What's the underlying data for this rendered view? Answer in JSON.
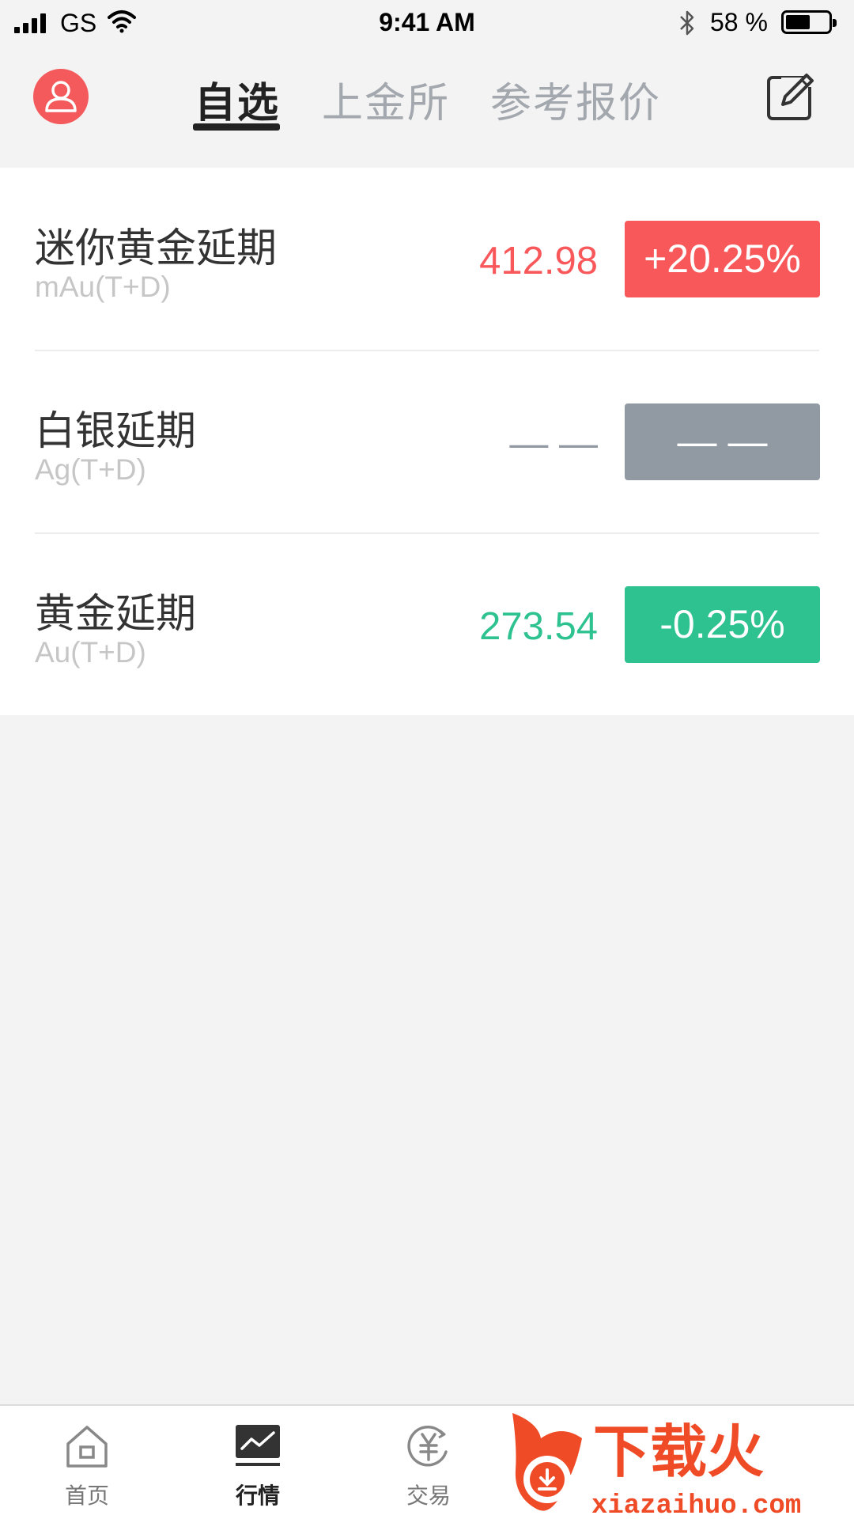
{
  "status_bar": {
    "carrier": "GS",
    "time": "9:41 AM",
    "battery_percent": "58 %",
    "battery_level": 0.58
  },
  "top_nav": {
    "tabs": [
      {
        "label": "自选",
        "active": true
      },
      {
        "label": "上金所",
        "active": false
      },
      {
        "label": "参考报价",
        "active": false
      }
    ],
    "avatar_icon": "user-icon",
    "edit_icon": "edit-icon"
  },
  "quotes": [
    {
      "name": "迷你黄金延期",
      "code": "mAu(T+D)",
      "price": "412.98",
      "change": "+20.25%",
      "trend": "up"
    },
    {
      "name": "白银延期",
      "code": "Ag(T+D)",
      "price": "— —",
      "change": "— —",
      "trend": "none"
    },
    {
      "name": "黄金延期",
      "code": "Au(T+D)",
      "price": "273.54",
      "change": "-0.25%",
      "trend": "down"
    }
  ],
  "colors": {
    "up": "#f9585b",
    "down": "#2dc28f",
    "none": "#9199a3",
    "accent": "#f4595b"
  },
  "bottom_tabs": [
    {
      "label": "首页",
      "icon": "home-icon",
      "active": false
    },
    {
      "label": "行情",
      "icon": "market-chart-icon",
      "active": true
    },
    {
      "label": "交易",
      "icon": "trade-yen-icon",
      "active": false
    }
  ],
  "watermark": {
    "logo_text": "下载火",
    "site": "xiazaihuo.com"
  }
}
